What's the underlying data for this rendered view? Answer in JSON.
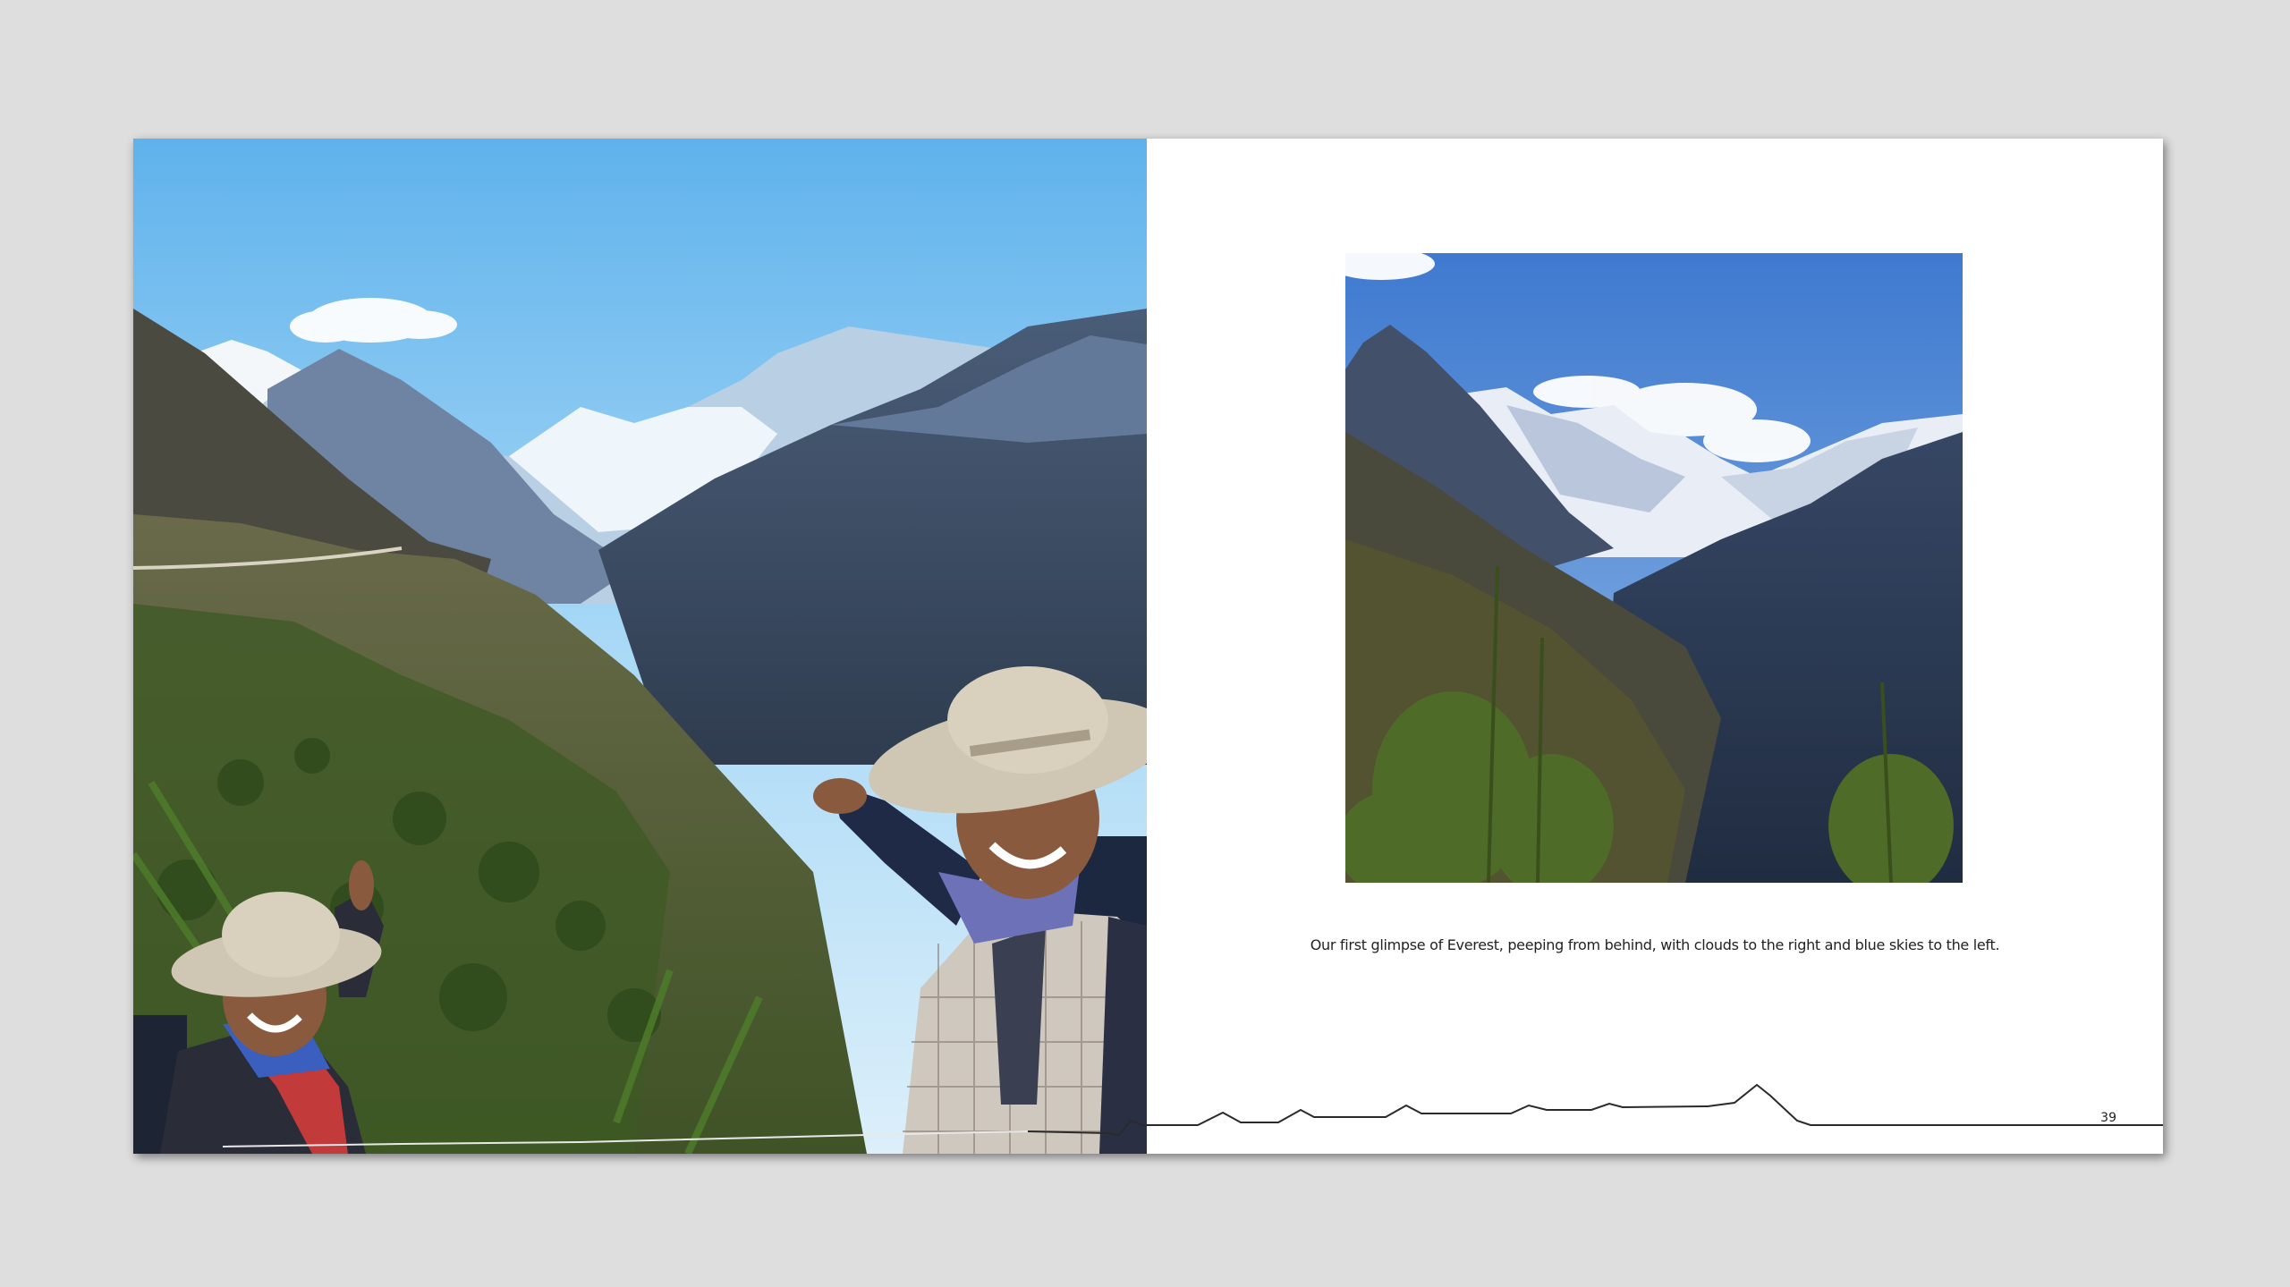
{
  "book": {
    "left_page": {
      "photo": "Two trekkers in sun hats pointing toward distant snow-capped Everest above a forested Himalayan valley"
    },
    "right_page": {
      "photo": "Everest and neighbouring snowy peaks framed by dark valley ridges and pine trees",
      "caption": "Our first glimpse of Everest, peeping from behind, with clouds to the right and blue skies to the left.",
      "page_number": "39"
    }
  }
}
